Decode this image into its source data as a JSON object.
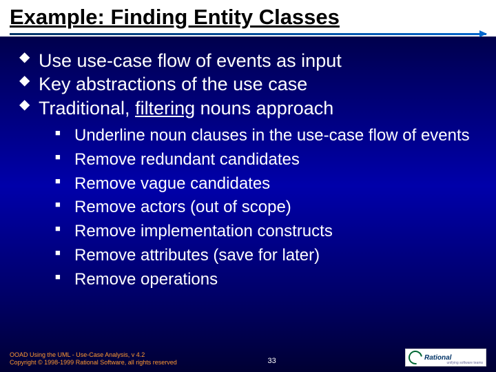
{
  "title": "Example: Finding Entity Classes",
  "main_bullets": [
    {
      "text": "Use use-case flow of events as input"
    },
    {
      "text": "Key abstractions of the use case"
    },
    {
      "prefix": "Traditional, ",
      "underlined": "filtering",
      "suffix": " nouns approach"
    }
  ],
  "sub_bullets": [
    "Underline noun clauses in the use-case flow of events",
    "Remove redundant candidates",
    "Remove vague candidates",
    "Remove actors (out of scope)",
    "Remove implementation constructs",
    "Remove attributes (save for later)",
    "Remove operations"
  ],
  "footer": {
    "line1": "OOAD Using the UML - Use-Case Analysis, v 4.2",
    "line2": "Copyright © 1998-1999 Rational Software, all rights reserved",
    "page": "33",
    "logo_main": "Rational",
    "logo_sub": "unifying software teams"
  }
}
